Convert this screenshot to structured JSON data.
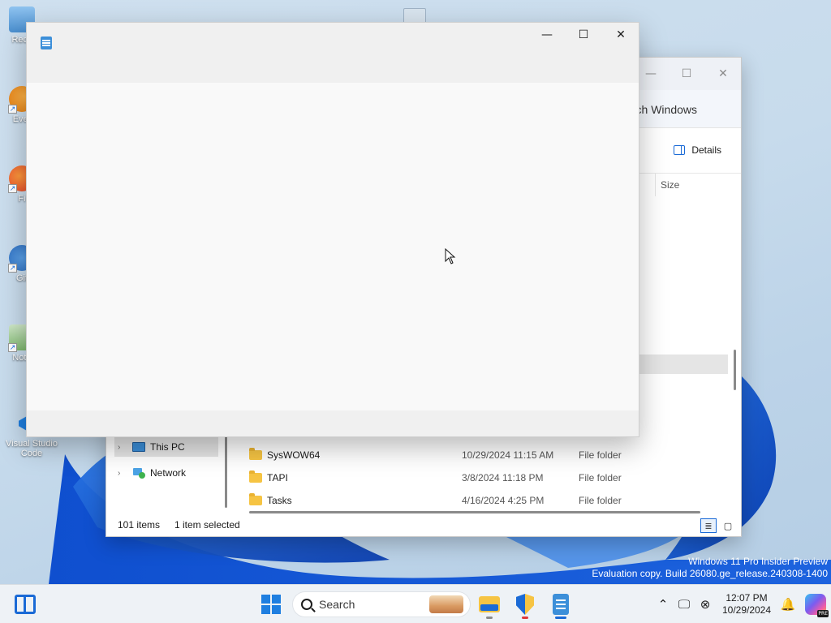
{
  "desktop": {
    "icons": [
      {
        "label": "Recy",
        "icon": "recycle-bin-icon"
      },
      {
        "label": "Ever",
        "icon": "everything-icon"
      },
      {
        "label": "Fi",
        "icon": "firefox-icon"
      },
      {
        "label": "Git",
        "icon": "git-icon"
      },
      {
        "label": "Note",
        "icon": "notepad-icon"
      },
      {
        "label": "Visual Studio Code",
        "icon": "vscode-icon"
      }
    ]
  },
  "front_window": {
    "icon": "notepad-icon",
    "minimize": "—",
    "maximize": "☐",
    "close": "✕"
  },
  "explorer": {
    "search_text": "ch Windows",
    "details_label": "Details",
    "size_column": "Size",
    "nav": {
      "this_pc": "This PC",
      "network": "Network",
      "chevron": "›"
    },
    "rows": [
      {
        "name": "SysWOW64",
        "date": "10/29/2024 11:15 AM",
        "type": "File folder"
      },
      {
        "name": "TAPI",
        "date": "3/8/2024 11:18 PM",
        "type": "File folder"
      },
      {
        "name": "Tasks",
        "date": "4/16/2024 4:25 PM",
        "type": "File folder"
      }
    ],
    "status": {
      "items": "101 items",
      "selected": "1 item selected"
    },
    "caption": {
      "minimize": "—",
      "maximize": "☐",
      "close": "✕"
    }
  },
  "watermark": {
    "line1": "Windows 11 Pro Insider Preview",
    "line2": "Evaluation copy. Build 26080.ge_release.240308-1400"
  },
  "taskbar": {
    "search_placeholder": "Search",
    "tray": {
      "chevron": "⌃",
      "time": "12:07 PM",
      "date": "10/29/2024",
      "bell": "🔔"
    }
  },
  "colors": {
    "accent": "#1a6ad6",
    "folder": "#f6c443",
    "selection": "#e5e5e5"
  }
}
